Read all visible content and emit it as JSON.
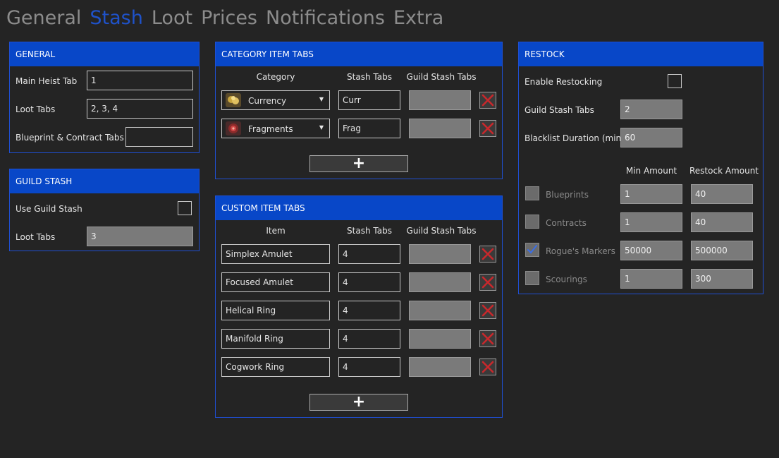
{
  "tabs": [
    {
      "label": "General"
    },
    {
      "label": "Stash",
      "active": true
    },
    {
      "label": "Loot"
    },
    {
      "label": "Prices"
    },
    {
      "label": "Notifications"
    },
    {
      "label": "Extra"
    }
  ],
  "general": {
    "title": "GENERAL",
    "main_heist_tab": {
      "label": "Main Heist Tab",
      "value": "1"
    },
    "loot_tabs": {
      "label": "Loot Tabs",
      "value": "2, 3, 4"
    },
    "blueprint_tabs": {
      "label": "Blueprint & Contract Tabs",
      "value": ""
    }
  },
  "guild_stash": {
    "title": "GUILD STASH",
    "use_label": "Use Guild Stash",
    "loot_tabs": {
      "label": "Loot Tabs",
      "value": "3"
    }
  },
  "category_tabs": {
    "title": "CATEGORY ITEM TABS",
    "headers": {
      "category": "Category",
      "stash": "Stash Tabs",
      "guild": "Guild Stash Tabs"
    },
    "rows": [
      {
        "category": "Currency",
        "stash": "Curr",
        "guild": "",
        "icon": "currency-icon"
      },
      {
        "category": "Fragments",
        "stash": "Frag",
        "guild": "",
        "icon": "fragments-icon"
      }
    ],
    "add_label": "+"
  },
  "custom_tabs": {
    "title": "CUSTOM ITEM TABS",
    "headers": {
      "item": "Item",
      "stash": "Stash Tabs",
      "guild": "Guild Stash Tabs"
    },
    "rows": [
      {
        "item": "Simplex Amulet",
        "stash": "4",
        "guild": ""
      },
      {
        "item": "Focused Amulet",
        "stash": "4",
        "guild": ""
      },
      {
        "item": "Helical Ring",
        "stash": "4",
        "guild": ""
      },
      {
        "item": "Manifold Ring",
        "stash": "4",
        "guild": ""
      },
      {
        "item": "Cogwork Ring",
        "stash": "4",
        "guild": ""
      }
    ],
    "add_label": "+"
  },
  "restock": {
    "title": "RESTOCK",
    "enable_label": "Enable Restocking",
    "guild_tabs": {
      "label": "Guild Stash Tabs",
      "value": "2"
    },
    "blacklist": {
      "label": "Blacklist Duration (min)",
      "value": "60"
    },
    "headers": {
      "min": "Min Amount",
      "restock": "Restock Amount"
    },
    "rows": [
      {
        "label": "Blueprints",
        "min": "1",
        "restock": "40",
        "checked": false
      },
      {
        "label": "Contracts",
        "min": "1",
        "restock": "40",
        "checked": false
      },
      {
        "label": "Rogue's Markers",
        "min": "50000",
        "restock": "500000",
        "checked": true
      },
      {
        "label": "Scourings",
        "min": "1",
        "restock": "300",
        "checked": false
      }
    ]
  },
  "colors": {
    "accent": "#0847c8",
    "active_tab": "#1f52c9",
    "delete": "#c8282c"
  }
}
